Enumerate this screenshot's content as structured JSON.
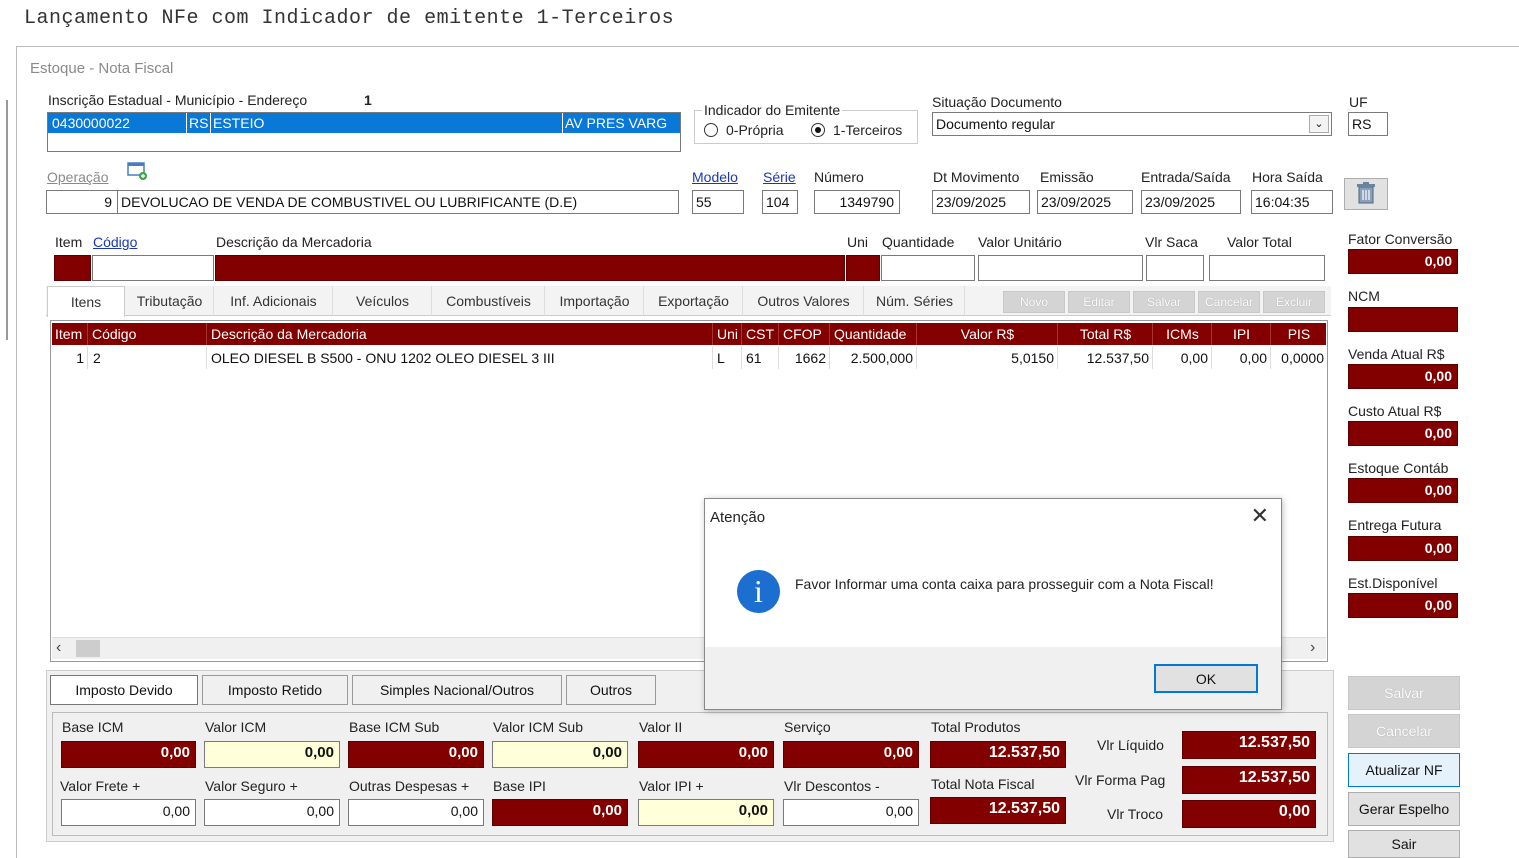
{
  "caption": "Lançamento NFe com Indicador de emitente 1-Terceiros",
  "window_title": "Estoque - Nota Fiscal",
  "ie": {
    "label": "Inscrição Estadual - Município - Endereço",
    "number": "1",
    "code": "0430000022",
    "uf_cell": "RS",
    "city": "ESTEIO",
    "address": "AV PRES VARG"
  },
  "indicador": {
    "legend": "Indicador do Emitente",
    "opt1": "0-Própria",
    "opt2": "1-Terceiros",
    "selected": "1-Terceiros"
  },
  "situacao": {
    "label": "Situação Documento",
    "value": "Documento regular"
  },
  "uf": {
    "label": "UF",
    "value": "RS"
  },
  "operacao": {
    "label": "Operação",
    "code": "9",
    "desc": "DEVOLUCAO DE VENDA DE COMBUSTIVEL OU LUBRIFICANTE (D.E)"
  },
  "modelo": {
    "label": "Modelo",
    "value": "55"
  },
  "serie": {
    "label": "Série",
    "value": "104"
  },
  "numero": {
    "label": "Número",
    "value": "1349790"
  },
  "dates": {
    "dt_mov_label": "Dt Movimento",
    "dt_mov": "23/09/2025",
    "emissao_label": "Emissão",
    "emissao": "23/09/2025",
    "entrada_label": "Entrada/Saída",
    "entrada": "23/09/2025",
    "hora_label": "Hora Saída",
    "hora": "16:04:35"
  },
  "entry": {
    "item": "Item",
    "codigo": "Código",
    "descricao": "Descrição da Mercadoria",
    "uni": "Uni",
    "quantidade": "Quantidade",
    "valor_unitario": "Valor Unitário",
    "vlr_saca": "Vlr Saca",
    "valor_total": "Valor Total"
  },
  "tabs": [
    "Itens",
    "Tributação",
    "Inf. Adicionais",
    "Veículos",
    "Combustíveis",
    "Importação",
    "Exportação",
    "Outros Valores",
    "Núm. Séries"
  ],
  "grid_buttons": [
    "Novo",
    "Editar",
    "Salvar",
    "Cancelar",
    "Excluir"
  ],
  "grid": {
    "headers": [
      "Item",
      "Código",
      "Descrição da Mercadoria",
      "Uni",
      "CST",
      "CFOP",
      "Quantidade",
      "Valor R$",
      "Total R$",
      "ICMs",
      "IPI",
      "PIS"
    ],
    "rows": [
      [
        "1",
        "2",
        "OLEO DIESEL B S500 - ONU 1202 OLEO DIESEL 3 III",
        "L",
        "61",
        "1662",
        "2.500,000",
        "5,0150",
        "12.537,50",
        "0,00",
        "0,00",
        "0,0000"
      ]
    ]
  },
  "right_panel": {
    "fator_label": "Fator Conversão",
    "fator": "0,00",
    "ncm_label": "NCM",
    "ncm": "",
    "venda_label": "Venda Atual R$",
    "venda": "0,00",
    "custo_label": "Custo Atual R$",
    "custo": "0,00",
    "estoque_label": "Estoque Contáb",
    "estoque": "0,00",
    "entrega_label": "Entrega Futura",
    "entrega": "0,00",
    "est_disp_label": "Est.Disponível",
    "est_disp": "0,00"
  },
  "bottom_tabs": [
    "Imposto Devido",
    "Imposto Retido",
    "Simples Nacional/Outros",
    "Outros"
  ],
  "taxes": {
    "base_icm_label": "Base ICM",
    "base_icm": "0,00",
    "valor_icm_label": "Valor ICM",
    "valor_icm": "0,00",
    "base_icm_sub_label": "Base ICM Sub",
    "base_icm_sub": "0,00",
    "valor_icm_sub_label": "Valor ICM Sub",
    "valor_icm_sub": "0,00",
    "valor_ii_label": "Valor II",
    "valor_ii": "0,00",
    "servico_label": "Serviço",
    "servico": "0,00",
    "total_produtos_label": "Total Produtos",
    "total_produtos": "12.537,50",
    "valor_frete_label": "Valor Frete +",
    "valor_frete": "0,00",
    "valor_seguro_label": "Valor Seguro +",
    "valor_seguro": "0,00",
    "outras_label": "Outras Despesas +",
    "outras": "0,00",
    "base_ipi_label": "Base IPI",
    "base_ipi": "0,00",
    "valor_ipi_label": "Valor IPI +",
    "valor_ipi": "0,00",
    "descontos_label": "Vlr Descontos -",
    "descontos": "0,00",
    "total_nf_label": "Total Nota Fiscal",
    "total_nf": "12.537,50",
    "liquido_label": "Vlr Líquido",
    "liquido": "12.537,50",
    "forma_pag_label": "Vlr Forma Pag",
    "forma_pag": "12.537,50",
    "troco_label": "Vlr Troco",
    "troco": "0,00"
  },
  "actions": {
    "salvar": "Salvar",
    "cancelar": "Cancelar",
    "atualizar": "Atualizar NF",
    "espelho": "Gerar Espelho",
    "sair": "Sair"
  },
  "dialog": {
    "title": "Atenção",
    "message": "Favor Informar uma conta caixa para prosseguir com a Nota Fiscal!",
    "ok": "OK"
  }
}
